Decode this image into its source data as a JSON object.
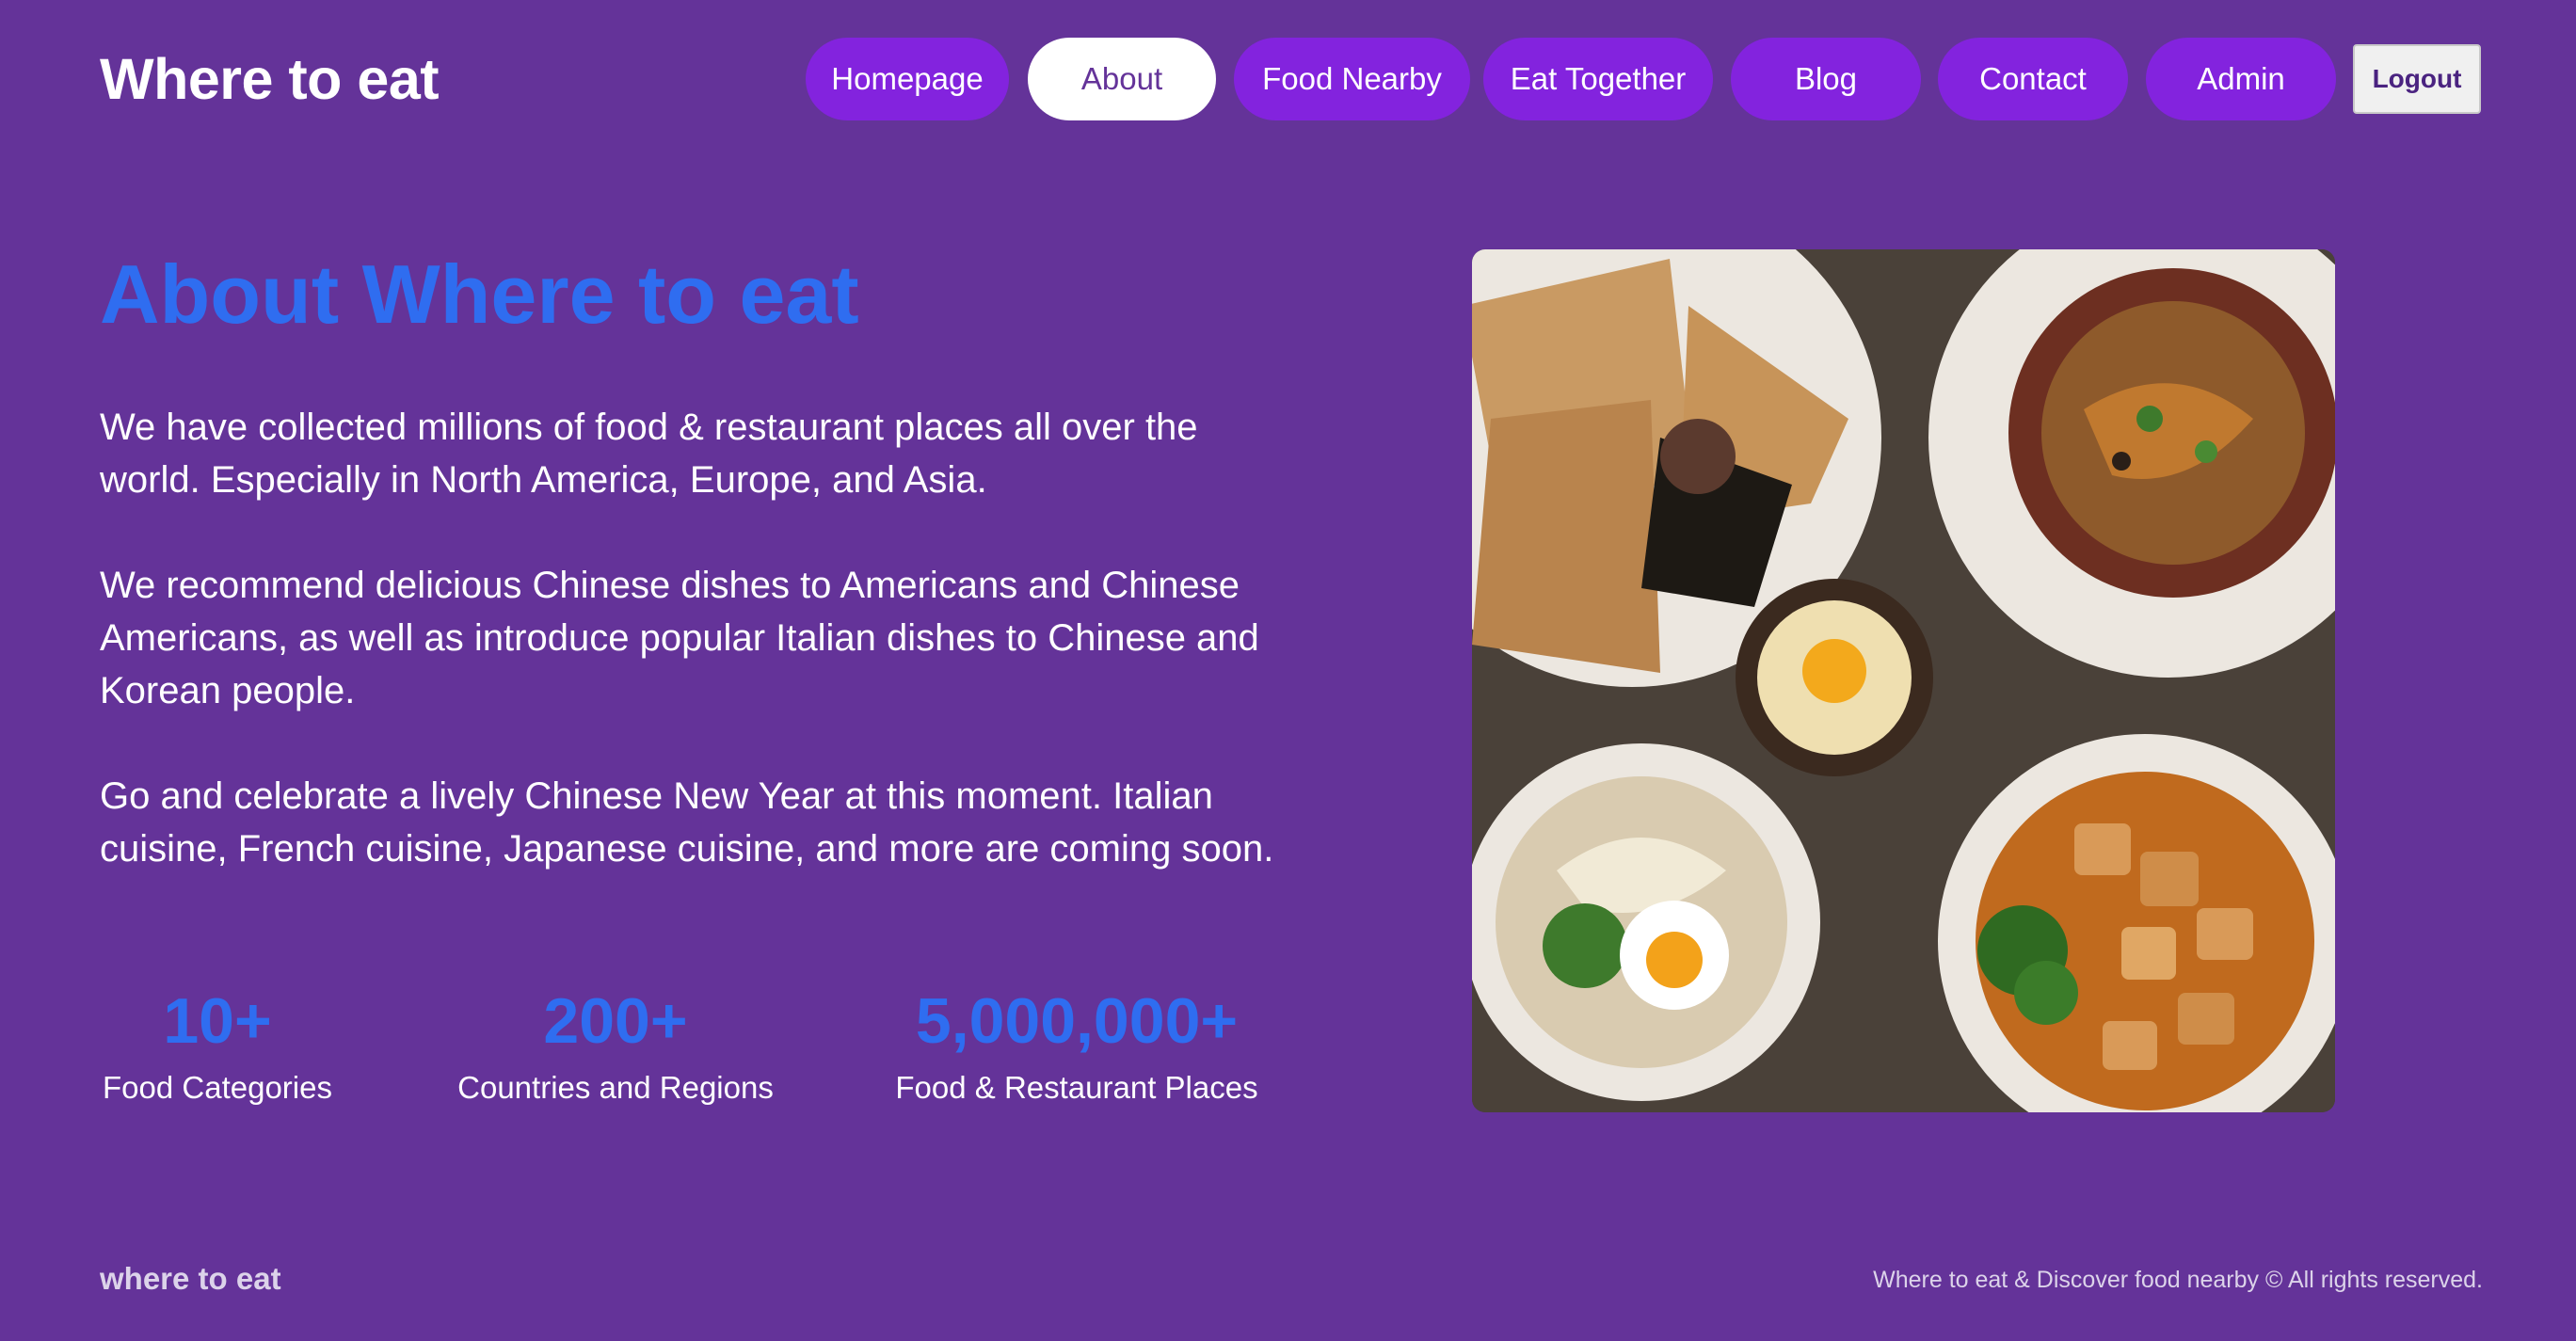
{
  "header": {
    "brand": "Where to eat",
    "nav": [
      {
        "label": "Homepage",
        "active": false
      },
      {
        "label": "About",
        "active": true
      },
      {
        "label": "Food Nearby",
        "active": false
      },
      {
        "label": "Eat Together",
        "active": false
      },
      {
        "label": "Blog",
        "active": false
      },
      {
        "label": "Contact",
        "active": false
      },
      {
        "label": "Admin",
        "active": false
      }
    ],
    "logout_label": "Logout"
  },
  "main": {
    "title": "About Where to eat",
    "paragraphs": [
      "We have collected millions of food & restaurant places all over the world. Especially in North America, Europe, and Asia.",
      "We recommend delicious Chinese dishes to Americans and Chinese Americans, as well as introduce popular Italian dishes to Chinese and Korean people.",
      "Go and celebrate a lively Chinese New Year at this moment. Italian cuisine, French cuisine, Japanese cuisine, and more are coming soon."
    ],
    "stats": [
      {
        "value": "10+",
        "label": "Food Categories"
      },
      {
        "value": "200+",
        "label": "Countries and Regions"
      },
      {
        "value": "5,000,000+",
        "label": "Food & Restaurant Places"
      }
    ]
  },
  "footer": {
    "brand": "where to eat",
    "copyright": "Where to eat & Discover food nearby © All rights reserved."
  },
  "colors": {
    "background": "#643399",
    "nav_pill": "#8323de",
    "accent_blue": "#2f6df0"
  }
}
